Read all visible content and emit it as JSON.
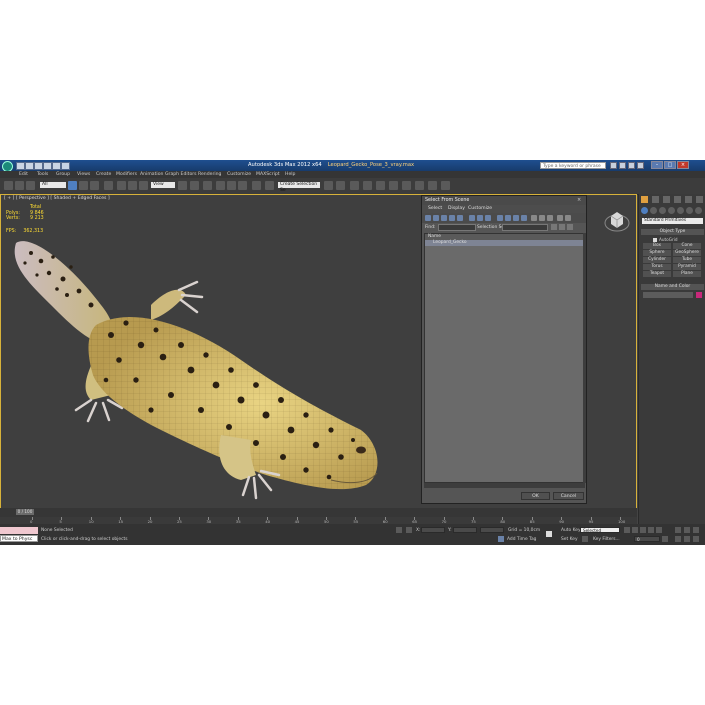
{
  "window": {
    "app_title": "Autodesk 3ds Max  2012 x64",
    "file_name": "Leopard_Gecko_Pose_3_vray.max",
    "search_placeholder": "Type a keyword or phrase"
  },
  "menu": [
    "Edit",
    "Tools",
    "Group",
    "Views",
    "Create",
    "Modifiers",
    "Animation",
    "Graph Editors",
    "Rendering",
    "Customize",
    "MAXScript",
    "Help"
  ],
  "toolbar": {
    "selection_filter": "All",
    "reference_coord": "View",
    "named_selection": "Create Selection Se"
  },
  "viewport": {
    "label": "[ + ] [ Perspective ] [ Shaded + Edged Faces ]",
    "stats_header": "Total",
    "polys_label": "Polys:",
    "polys_value": "9 846",
    "verts_label": "Verts:",
    "verts_value": "9 213",
    "fps_label": "FPS:",
    "fps_value": "362,313"
  },
  "dialog": {
    "title": "Select From Scene",
    "menu": [
      "Select",
      "Display",
      "Customize"
    ],
    "find_label": "Find:",
    "selection_set_label": "Selection Set:",
    "column_name": "Name",
    "objects": [
      "Leopard_Gecko"
    ],
    "ok_label": "OK",
    "cancel_label": "Cancel"
  },
  "command_panel": {
    "category": "Standard Primitives",
    "object_type_title": "Object Type",
    "autogrid_label": "AutoGrid",
    "primitives": [
      "Box",
      "Cone",
      "Sphere",
      "GeoSphere",
      "Cylinder",
      "Tube",
      "Torus",
      "Pyramid",
      "Teapot",
      "Plane"
    ],
    "name_color_title": "Name and Color"
  },
  "timeline": {
    "slider_label": "0 / 100",
    "ticks": [
      "0",
      "5",
      "10",
      "15",
      "20",
      "25",
      "30",
      "35",
      "40",
      "45",
      "50",
      "55",
      "60",
      "65",
      "70",
      "75",
      "80",
      "85",
      "90",
      "95",
      "100"
    ]
  },
  "status": {
    "maxscript_label": "Max to Physc",
    "selection_text": "None Selected",
    "prompt_text": "Click or click-and-drag to select objects",
    "x_label": "X:",
    "y_label": "Y:",
    "grid_text": "Grid = 10,0cm",
    "add_time_tag": "Add Time Tag",
    "auto_key": "Auto Key",
    "selected_dropdown": "Selected",
    "set_key": "Set Key",
    "key_filters": "Key Filters...",
    "frame_value": "0"
  },
  "colors": {
    "titlebar": "#1f4f8f",
    "active_viewport_border": "#d7b23a",
    "stats_text": "#ffdd33",
    "object_color_swatch": "#c8287a"
  }
}
